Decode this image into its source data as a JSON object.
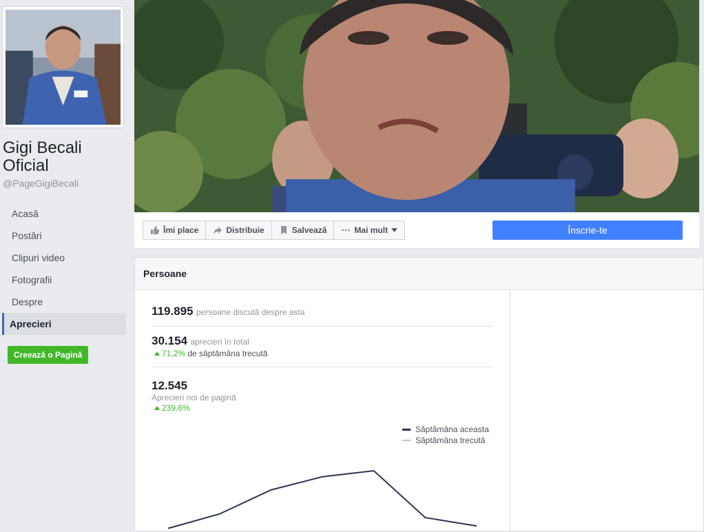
{
  "page": {
    "name": "Gigi Becali Oficial",
    "handle": "@PageGigiBecali"
  },
  "nav": {
    "items": [
      {
        "label": "Acasă"
      },
      {
        "label": "Postări"
      },
      {
        "label": "Clipuri video"
      },
      {
        "label": "Fotografii"
      },
      {
        "label": "Despre"
      },
      {
        "label": "Aprecieri"
      }
    ],
    "active_index": 5,
    "create_page_label": "Creează o Pagină"
  },
  "actions": {
    "like": "Îmi place",
    "share": "Distribuie",
    "save": "Salvează",
    "more": "Mai mult",
    "join": "Înscrie-te"
  },
  "panel": {
    "title": "Persoane",
    "talking": {
      "number": "119.895",
      "label": "persoane discută despre asta"
    },
    "total_likes": {
      "number": "30.154",
      "label": "aprecieri în total",
      "change": "71,2%",
      "change_label": "de săptămâna trecută"
    },
    "new_likes": {
      "number": "12.545",
      "label": "Aprecieri noi de pagină",
      "change": "239,6%"
    }
  },
  "colors": {
    "accent": "#4267b2",
    "join_button": "#4080ff",
    "positive": "#42b72a",
    "this_week": "#29344f",
    "last_week": "#bec3c9"
  },
  "chart_data": {
    "type": "line",
    "x": [
      1,
      2,
      3,
      4,
      5,
      6,
      7
    ],
    "series": [
      {
        "name": "Săptămâna aceasta",
        "values": [
          150,
          750,
          1750,
          2300,
          2550,
          600,
          250
        ]
      },
      {
        "name": "Săptămâna trecută",
        "values": []
      }
    ],
    "ylim": [
      0,
      3500
    ],
    "grid": false,
    "legend_position": "top-right"
  }
}
